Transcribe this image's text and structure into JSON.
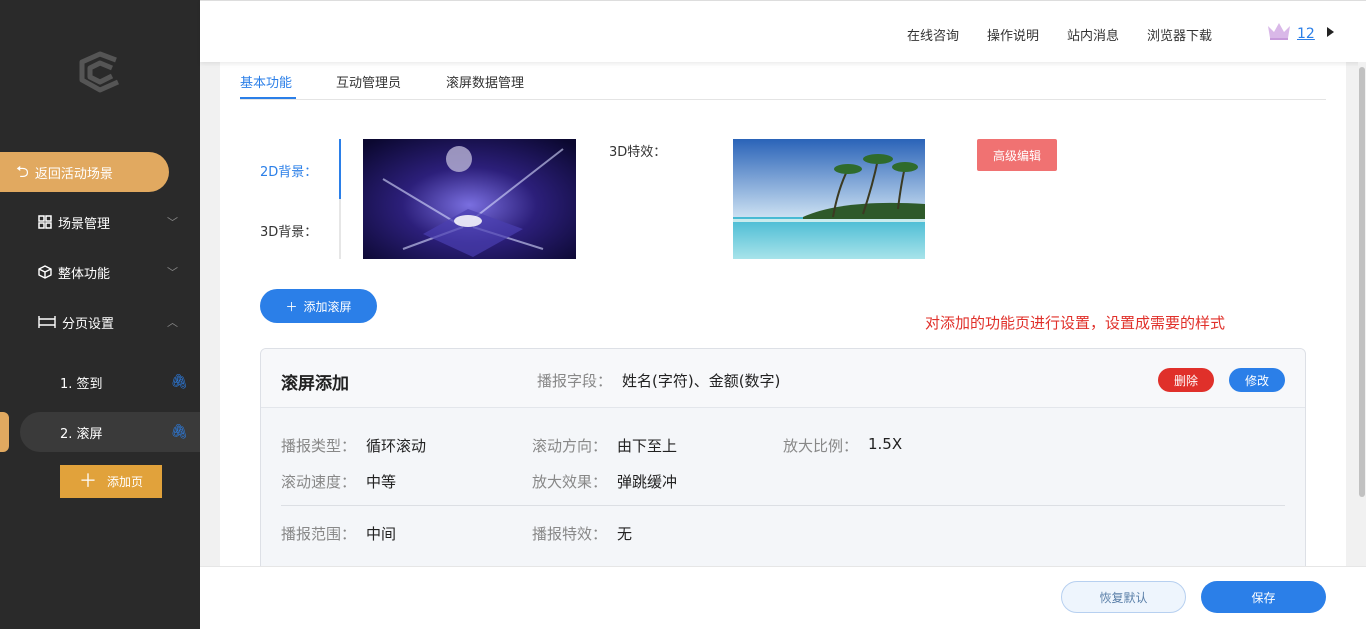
{
  "sidebar": {
    "back_label": "返回活动场景",
    "nav": [
      {
        "label": "场景管理",
        "icon": "grid-icon"
      },
      {
        "label": "整体功能",
        "icon": "cube-icon"
      },
      {
        "label": "分页设置",
        "icon": "layout-icon"
      }
    ],
    "pages": [
      {
        "label": "1. 签到"
      },
      {
        "label": "2. 滚屏"
      }
    ],
    "add_page_label": "添加页"
  },
  "topbar": {
    "links": [
      "在线咨询",
      "操作说明",
      "站内消息",
      "浏览器下载"
    ],
    "vip_count": "12"
  },
  "tabs": [
    "基本功能",
    "互动管理员",
    "滚屏数据管理"
  ],
  "background": {
    "label_2d": "2D背景：",
    "label_3d": "3D背景：",
    "fx_label": "3D特效：",
    "advanced_edit": "高级编辑"
  },
  "add_scroll_label": "添加滚屏",
  "hint_text": "对添加的功能页进行设置，设置成需要的样式",
  "card": {
    "title": "滚屏添加",
    "broadcast_fields_key": "播报字段：",
    "broadcast_fields_value": "姓名(字符)、金额(数字)",
    "delete_label": "删除",
    "edit_label": "修改",
    "rows": [
      [
        {
          "k": "播报类型：",
          "v": "循环滚动"
        },
        {
          "k": "滚动方向：",
          "v": "由下至上"
        },
        {
          "k": "放大比例：",
          "v": "1.5X"
        }
      ],
      [
        {
          "k": "滚动速度：",
          "v": "中等"
        },
        {
          "k": "放大效果：",
          "v": "弹跳缓冲"
        }
      ],
      [
        {
          "k": "播报范围：",
          "v": "中间"
        },
        {
          "k": "播报特效：",
          "v": "无"
        }
      ]
    ]
  },
  "footer": {
    "restore_label": "恢复默认",
    "save_label": "保存"
  },
  "colors": {
    "accent": "#2b7fe8",
    "sidebar_bg": "#2a2a2a",
    "gold": "#e1a960",
    "danger": "#e0302a"
  }
}
